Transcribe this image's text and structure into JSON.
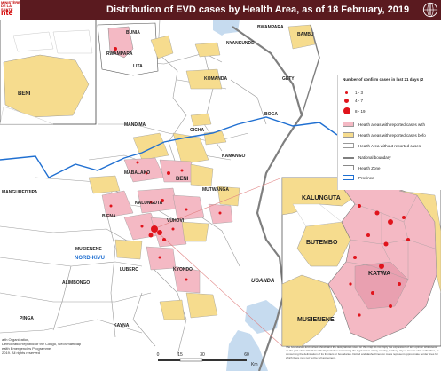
{
  "title": "Distribution of EVD cases by Health Area, as of 18 February, 2019",
  "ministry": {
    "line1": "MINISTÈRE DE LA SANTÉ",
    "logo_text": "nté"
  },
  "colors": {
    "header": "#5a1a1f",
    "reported_21d": "#f4b9c4",
    "reported_before": "#f6dc8e",
    "no_cases": "#ffffff",
    "case_dot": "#e0141c",
    "province": "#1f6fd1",
    "lake": "#c6dbef"
  },
  "legend": {
    "title": "Number of confirm cases in last 21 days (2",
    "dots": [
      "1 - 3",
      "4 - 7",
      "8 - 19"
    ],
    "fills": [
      "Health areas with reported cases with",
      "Health areas with reported cases befo",
      "Health Area without reported cases"
    ],
    "lines": [
      "National boundary",
      "Health Zone",
      "Province"
    ]
  },
  "labels": {
    "bunia": "BUNIA",
    "rwampara": "RWAMPARA",
    "lita": "LITA",
    "nyankunde": "NYANKUNDE",
    "bambu": "BAMBU",
    "bwampara2": "BWAMPARA",
    "komanda": "KOMANDA",
    "gety": "GETY",
    "boga": "BOGA",
    "mandima": "MANDIMA",
    "oicha": "OICHA",
    "kamango": "KAMANGO",
    "mabalako": "MABALAKO",
    "beni": "BENI",
    "beni_inset": "BENI",
    "mutwanga": "MUTWANGA",
    "manguredjipa": "MANGUREDJIPA",
    "kalunguta": "KALUNGUTA",
    "biena": "BIENA",
    "vuhovi": "VUHOVI",
    "musienene": "MUSIENENE",
    "nord_kivu": "NORD-KIVU",
    "lubero": "LUBERO",
    "kyondo": "KYONDO",
    "alimbongo": "ALIMBONGO",
    "uganda": "UGANDA",
    "pinga": "PINGA",
    "kayna": "KAYNA",
    "inset_kalunguta": "KALUNGUTA",
    "inset_butembo": "BUTEMBO",
    "inset_katwa": "KATWA",
    "inset_musienene": "MUSIENENE"
  },
  "scale": {
    "ticks": [
      "0",
      "15",
      "30",
      "60"
    ],
    "unit": "Km"
  },
  "credit": [
    "alth Organization,",
    "Democratic Republic of the Congo, GeoSmartMap",
    "ealth Emergencies Programme",
    "2019. All rights reserved"
  ],
  "disclaimer": "The boundaries and names shown and the designations used on this map do not imply the expression of any opinion whatsoever on the part of the World Health Organization concerning the legal status of any country, territory, city or area or of its authorities, or concerning the delimitation of its frontiers or boundaries. Dotted and dashed lines on maps represent approximate border lines for which there may not yet be full agreement."
}
